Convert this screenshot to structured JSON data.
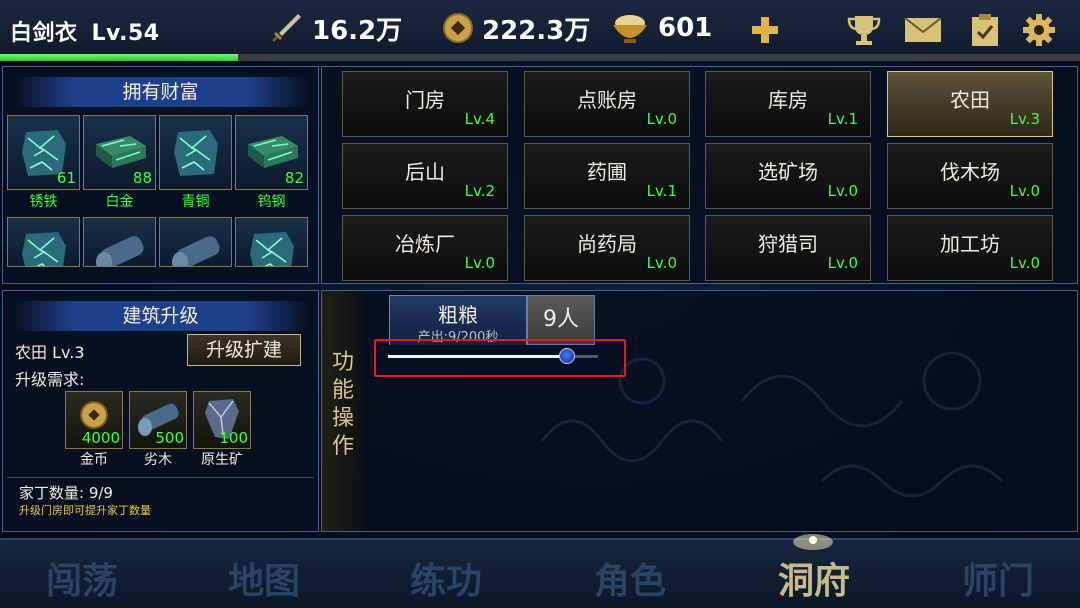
{
  "player": {
    "name": "白剑衣",
    "level": "Lv.54"
  },
  "resources": {
    "power": "16.2万",
    "coins": "222.3万",
    "food": "601"
  },
  "exp_progress": 0.22,
  "wealth": {
    "title": "拥有财富",
    "items": [
      {
        "name": "锈铁",
        "count": "61",
        "icon": "ore-icon"
      },
      {
        "name": "白金",
        "count": "88",
        "icon": "ingot-icon"
      },
      {
        "name": "青铜",
        "count": "",
        "icon": "ore-icon"
      },
      {
        "name": "钨钢",
        "count": "82",
        "icon": "ingot-icon"
      }
    ]
  },
  "buildings": [
    {
      "name": "门房",
      "level": "Lv.4"
    },
    {
      "name": "点账房",
      "level": "Lv.0"
    },
    {
      "name": "库房",
      "level": "Lv.1"
    },
    {
      "name": "农田",
      "level": "Lv.3"
    },
    {
      "name": "后山",
      "level": "Lv.2"
    },
    {
      "name": "药圃",
      "level": "Lv.1"
    },
    {
      "name": "选矿场",
      "level": "Lv.0"
    },
    {
      "name": "伐木场",
      "level": "Lv.0"
    },
    {
      "name": "冶炼厂",
      "level": "Lv.0"
    },
    {
      "name": "尚药局",
      "level": "Lv.0"
    },
    {
      "name": "狩猎司",
      "level": "Lv.0"
    },
    {
      "name": "加工坊",
      "level": "Lv.0"
    }
  ],
  "upgrade": {
    "title": "建筑升级",
    "building": "农田 Lv.3",
    "button": "升级扩建",
    "req_label": "升级需求:",
    "requirements": [
      {
        "name": "金币",
        "amount": "4000"
      },
      {
        "name": "劣木",
        "amount": "500"
      },
      {
        "name": "原生矿",
        "amount": "100"
      }
    ],
    "servants": "家丁数量: 9/9",
    "hint": "升级门房即可提升家丁数量"
  },
  "function": {
    "side_label": "功能操作",
    "product": "粗粮",
    "output": "产出:9/200秒",
    "workers": "9人",
    "slider_value": 0.85
  },
  "nav": [
    "闯荡",
    "地图",
    "练功",
    "角色",
    "洞府",
    "师门"
  ],
  "active_tab": "洞府",
  "colors": {
    "accent_gold": "#c8b88a",
    "green": "#3cff3c"
  }
}
